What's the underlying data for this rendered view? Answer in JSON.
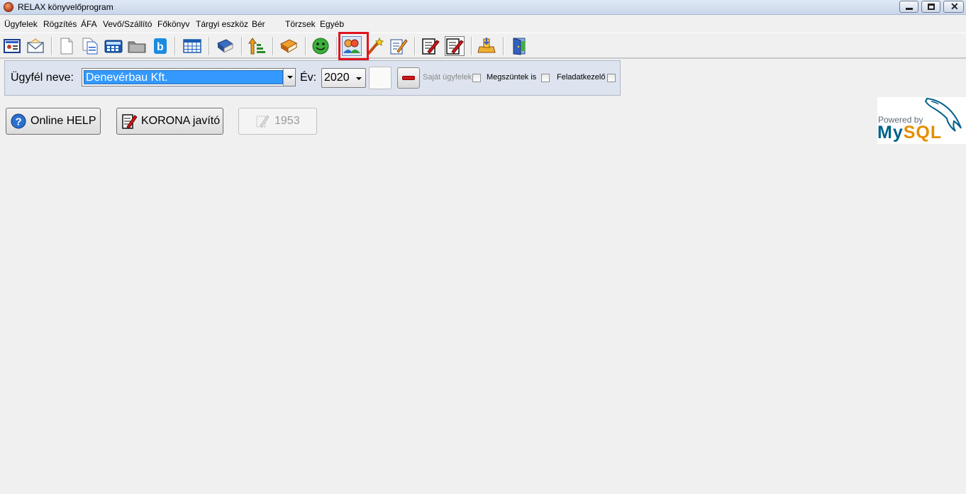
{
  "window": {
    "title": "RELAX könyvelőprogram"
  },
  "menu": [
    "Ügyfelek",
    "Rögzítés",
    "ÁFA",
    "Vevő/Szállító",
    "Főkönyv",
    "Tárgyi eszköz",
    "Bér",
    "Törzsek",
    "Egyéb"
  ],
  "client": {
    "label": "Ügyfél neve:",
    "value": "Denevérbau Kft.",
    "year_label": "Év:",
    "year_value": "2020",
    "own_clients_label": "Saját ügyfelek",
    "terminated_label": "Megszüntek is",
    "task_manager_label": "Feladatkezelő"
  },
  "buttons": {
    "help": "Online HELP",
    "korona": "KORONA javító",
    "number": "1953"
  },
  "logo": {
    "powered": "Powered by",
    "my": "My",
    "sql": "SQL"
  },
  "colors": {
    "selection": "#3399ff",
    "highlight": "#e0141e",
    "mysql_blue": "#00618a",
    "mysql_orange": "#e48e00"
  },
  "toolbar_icons": [
    "client-card-icon",
    "mail-icon",
    "document-icon",
    "documents-icon",
    "calculator-icon",
    "folder-icon",
    "b-icon",
    "grid-icon",
    "book-icon",
    "sort-up-icon",
    "books-icon",
    "smiley-icon",
    "people-icon",
    "magic-wand-icon",
    "edit-pencil-icon",
    "edit-red-icon",
    "edit-red-pressed-icon",
    "database-icon",
    "exit-door-icon"
  ]
}
